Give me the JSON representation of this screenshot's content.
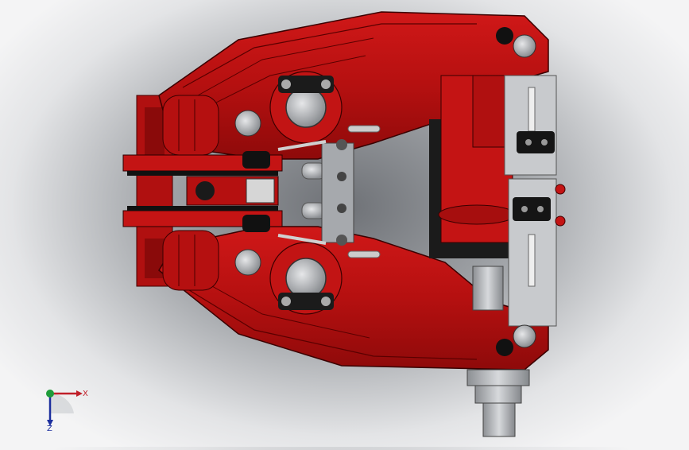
{
  "triad": {
    "x_label": "X",
    "z_label": "Z",
    "x_color": "#c0202a",
    "z_color": "#1c2f9e",
    "y_color": "#1e9c3a"
  },
  "model": {
    "body_color": "#c41414",
    "shadow_color": "#7a0a0a",
    "metal_color": "#b9bcc0",
    "pad_color": "#111111",
    "icons": [
      "bolt-icon",
      "nut-icon",
      "sensor-icon",
      "coordinate-triad-icon"
    ]
  }
}
